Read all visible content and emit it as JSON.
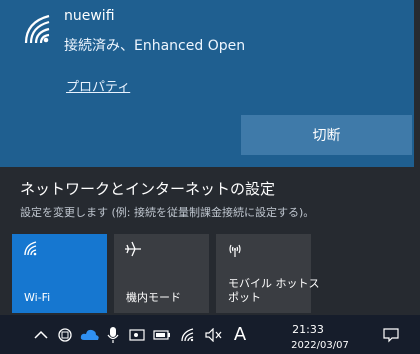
{
  "network": {
    "name": "nuewifi",
    "status": "接続済み、Enhanced Open",
    "properties_link": "プロパティ",
    "disconnect_button": "切断"
  },
  "settings": {
    "title": "ネットワークとインターネットの設定",
    "description": "設定を変更します (例: 接続を従量制課金接続に設定する)。"
  },
  "quick_actions": [
    {
      "label": "Wi-Fi",
      "icon": "wifi-icon",
      "active": true
    },
    {
      "label": "機内モード",
      "icon": "airplane-icon",
      "active": false
    },
    {
      "label": "モバイル ホットス\nポット",
      "icon": "hotspot-icon",
      "active": false
    }
  ],
  "taskbar": {
    "icons": [
      "chevron-up-icon",
      "app-icon",
      "cloud-icon",
      "microphone-icon",
      "meet-icon",
      "battery-icon",
      "wifi-icon",
      "volume-icon",
      "ime-icon",
      "notification-icon"
    ],
    "ime": "A",
    "time": "21:33",
    "date": "2022/03/07"
  },
  "colors": {
    "accent": "#1677d0",
    "network_card": "#1f5f90",
    "panel": "#262a30",
    "taskbar": "#161d2b"
  }
}
